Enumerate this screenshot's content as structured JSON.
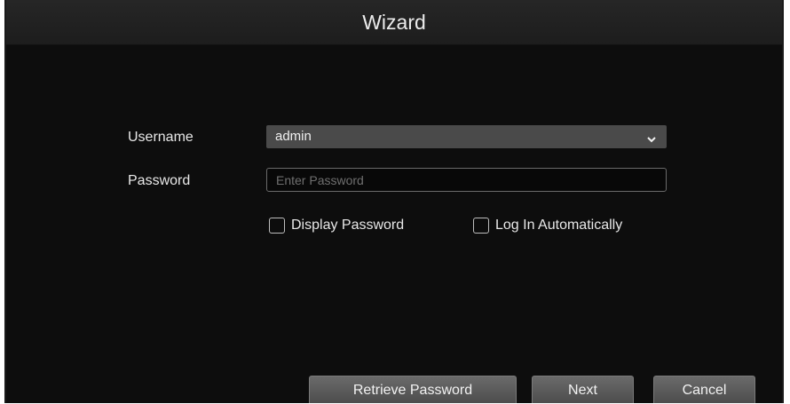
{
  "window": {
    "title": "Wizard"
  },
  "form": {
    "username_label": "Username",
    "username_value": "admin",
    "password_label": "Password",
    "password_placeholder": "Enter Password",
    "display_password_label": "Display Password",
    "display_password_checked": false,
    "auto_login_label": "Log In Automatically",
    "auto_login_checked": false
  },
  "footer": {
    "retrieve_label": "Retrieve Password",
    "next_label": "Next",
    "cancel_label": "Cancel"
  },
  "icons": {
    "dropdown": "chevron-down-icon"
  },
  "colors": {
    "background": "#0d0d0d",
    "titlebar": "#222222",
    "select_bg": "#4a4a4a",
    "button_bg": "#5c5c5c",
    "text": "#e8e8e8"
  }
}
